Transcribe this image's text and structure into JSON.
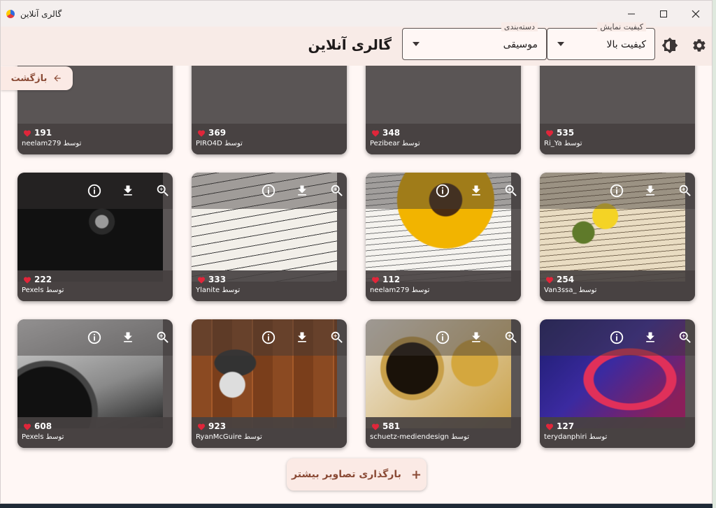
{
  "window": {
    "title": "گالری آنلاین"
  },
  "appbar": {
    "title": "گالری آنلاین",
    "category": {
      "label": "دسته‌بندی",
      "value": "موسیقی"
    },
    "quality": {
      "label": "کیفیت نمایش",
      "value": "کیفیت بالا"
    },
    "icons": {
      "theme": "brightness-icon",
      "settings": "gear-icon"
    }
  },
  "back_button": {
    "label": "بازگشت"
  },
  "load_more": {
    "label": "بارگذاری تصاویر بیشتر"
  },
  "cards": [
    {
      "likes": "191",
      "author": "neelam279 توسط",
      "partial": true
    },
    {
      "likes": "369",
      "author": "PIRO4D توسط",
      "partial": true
    },
    {
      "likes": "348",
      "author": "Pezibear توسط",
      "partial": true
    },
    {
      "likes": "535",
      "author": "Ri_Ya توسط",
      "partial": true
    },
    {
      "likes": "222",
      "author": "Pexels توسط",
      "scene": "microphone"
    },
    {
      "likes": "333",
      "author": "Ylanite توسط",
      "scene": "sheet-music"
    },
    {
      "likes": "112",
      "author": "neelam279 توسط",
      "scene": "sunflower"
    },
    {
      "likes": "254",
      "author": "Van3ssa_ توسط",
      "scene": "mimosa"
    },
    {
      "likes": "608",
      "author": "Pexels توسط",
      "scene": "turntable"
    },
    {
      "likes": "923",
      "author": "RyanMcGuire توسط",
      "scene": "banjo"
    },
    {
      "likes": "581",
      "author": "schuetz-mediendesign توسط",
      "scene": "saxophone"
    },
    {
      "likes": "127",
      "author": "terydanphiri توسط",
      "scene": "headphones"
    }
  ],
  "colors": {
    "accent": "#8a4a35",
    "appbar_bg": "#f8ebe7",
    "heart": "#e0263a"
  }
}
